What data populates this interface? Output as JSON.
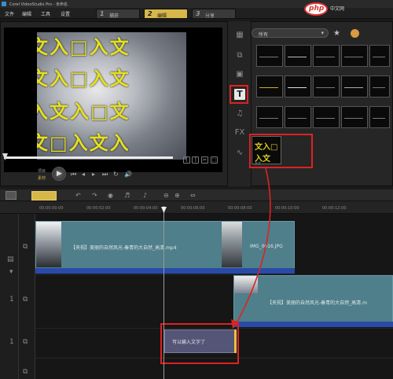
{
  "app": {
    "title": "Corel VideoStudio Pro - 未命名",
    "menu": [
      "文件",
      "编辑",
      "工具",
      "设置"
    ],
    "steps": [
      {
        "num": "1",
        "label": "捕获"
      },
      {
        "num": "2",
        "label": "编辑"
      },
      {
        "num": "3",
        "label": "分享"
      }
    ]
  },
  "preview": {
    "motif_rows": [
      "文入□入文",
      "入文入□文",
      "文□入文入"
    ],
    "mode_label_1": "项目",
    "mode_label_2": "素材"
  },
  "library": {
    "category": "所有",
    "thumb_labels": [
      "",
      "",
      "",
      "",
      "",
      "",
      "",
      "",
      "",
      "",
      "",
      "",
      "",
      "",
      "",
      ""
    ],
    "selected_label": "文字"
  },
  "timeline": {
    "ruler_ticks": [
      "00:00:00:00",
      "00:00:02:00",
      "00:00:04:00",
      "00:00:06:00",
      "00:00:08:00",
      "00:00:10:00",
      "00:00:12:00"
    ],
    "video_clip_label": "【央视】美丽的自然风光-秦青的大自然_高清.mp4",
    "video_clip_label_2": "IMG_0016.JPG",
    "overlay_clip_label": "【央视】美丽的自然风光-秦青的大自然_高清.m",
    "title_clip_label": "可以输入文字了"
  },
  "watermark": {
    "badge": "php",
    "text": "中文网"
  },
  "colors": {
    "accent": "#d6b74a",
    "highlight_box": "#dd2222",
    "clip": "#4f7f8a",
    "title_clip": "#555577"
  }
}
